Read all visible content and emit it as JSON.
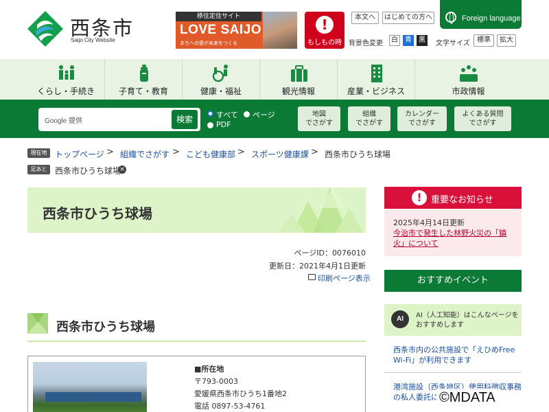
{
  "header": {
    "logo_name": "西条市",
    "logo_sub": "Saijo City Website",
    "banner": {
      "top": "移住定住サイト",
      "main": "LOVE SAIJO",
      "sub": "まちへの愛が未来をつくる"
    },
    "moshimo_label": "もしもの時",
    "text_button": "本文へ",
    "first_visit_button": "はじめての方へ",
    "foreign_language": "Foreign language",
    "bg_color_label": "背景色変更",
    "bg_white": "白",
    "bg_blue": "青",
    "bg_black": "黒",
    "font_size_label": "文字サイズ",
    "font_standard": "標準",
    "font_large": "拡大"
  },
  "nav": {
    "items": [
      {
        "label": "くらし・手続き"
      },
      {
        "label": "子育て・教育"
      },
      {
        "label": "健康・福祉"
      },
      {
        "label": "観光情報"
      },
      {
        "label": "産業・ビジネス"
      },
      {
        "label": "市政情報"
      }
    ]
  },
  "search": {
    "google_label": "Google 提供",
    "button": "検索",
    "opt_all": "すべて",
    "opt_page": "ページ",
    "opt_pdf": "PDF",
    "find_by": [
      {
        "line1": "地図",
        "line2": "でさがす"
      },
      {
        "line1": "組織",
        "line2": "でさがす"
      },
      {
        "line1": "カレンダー",
        "line2": "でさがす"
      },
      {
        "line1": "よくある質問",
        "line2": "でさがす"
      }
    ]
  },
  "breadcrumb": {
    "current_tag": "現在地",
    "items": [
      "トップページ",
      "組織でさがす",
      "こども健康部",
      "スポーツ健康課",
      "西条市ひうち球場"
    ],
    "separator": ">",
    "history_tag": "足あと",
    "history_item": "西条市ひうち球場",
    "history_close": "×"
  },
  "main": {
    "page_title": "西条市ひうち球場",
    "page_id": "ページID：0076010",
    "updated": "更新日：2021年4月1日更新",
    "print_link": "印刷ページ表示",
    "heading": "西条市ひうち球場",
    "location_label": "■所在地",
    "postal": "〒793-0003",
    "address": "愛媛県西条市ひうち1番地2",
    "phone": "電話 0897-53-4761"
  },
  "sidebar": {
    "notice_title": "重要なお知らせ",
    "notice_date": "2025年4月14日更新",
    "notice_link": "今治市で発生した林野火災の「鎮火」について",
    "event_title": "おすすめイベント",
    "ai_circle": "AI",
    "ai_text": "AI（人工知能）はこんなページをおすすめします",
    "links": [
      "西条市内の公共施設で「えひめFree Wi-Fi」が利用できます",
      "港湾施設（西条地区）使用料徴収事務の私人委託について"
    ]
  },
  "copyright": "©MDATA",
  "colors": {
    "brand_green": "#0a7a34",
    "light_green": "#e8f3e4",
    "alert_red": "#d9103a"
  }
}
